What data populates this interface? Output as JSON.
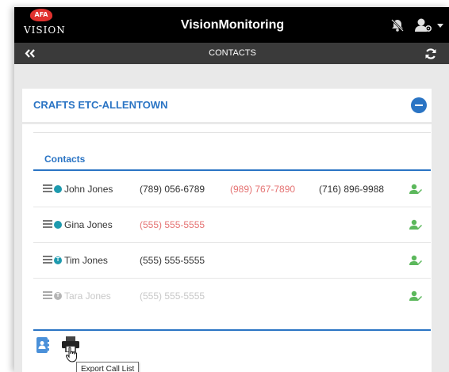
{
  "app": {
    "logo_badge": "AFA",
    "logo_text": "VISION",
    "title": "VisionMonitoring"
  },
  "nav": {
    "back_icon": "double-chevron-left-icon",
    "title": "CONTACTS",
    "refresh_icon": "refresh-icon"
  },
  "account": {
    "header": "CRAFTS ETC-ALLENTOWN",
    "collapse_icon": "minus-circle-icon"
  },
  "contacts": {
    "tab_label": "Contacts",
    "rows": [
      {
        "name": "John Jones",
        "status": "teal-dot",
        "phones": [
          {
            "value": "(789) 056-6789",
            "color": "#333333"
          },
          {
            "value": "(989) 767-7890",
            "color": "#e57373"
          },
          {
            "value": "(716) 896-9988",
            "color": "#333333"
          }
        ],
        "name_color": "#333333"
      },
      {
        "name": "Gina Jones",
        "status": "teal-dot",
        "phones": [
          {
            "value": "(555) 555-5555",
            "color": "#e57373"
          }
        ],
        "name_color": "#333333"
      },
      {
        "name": "Tim Jones",
        "status": "teal-t-badge",
        "badge": "T",
        "phones": [
          {
            "value": "(555) 555-5555",
            "color": "#333333"
          }
        ],
        "name_color": "#333333"
      },
      {
        "name": "Tara Jones",
        "status": "gray-t-badge",
        "badge": "T",
        "phones": [
          {
            "value": "(555) 555-5555",
            "color": "#c8c8c8"
          }
        ],
        "name_color": "#c8c8c8"
      }
    ]
  },
  "footer": {
    "contact_book_icon": "contact-book-icon",
    "print_icon": "printer-icon",
    "tooltip": "Export Call List"
  },
  "colors": {
    "brand_red": "#e0312e",
    "accent_blue": "#2a74c4",
    "status_teal": "#1e9aae",
    "edit_green": "#5cb85c",
    "alert_red": "#e57373"
  }
}
